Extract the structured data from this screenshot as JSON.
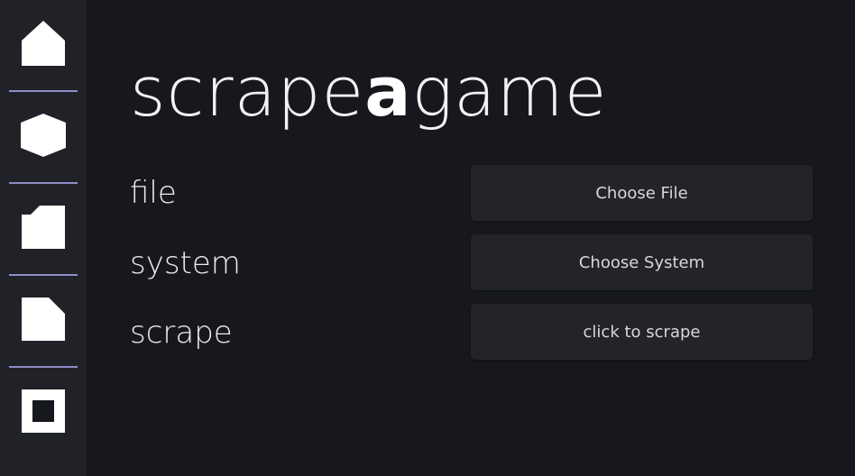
{
  "title": {
    "prefix": "scrape",
    "bold": "a",
    "suffix": "game"
  },
  "sidebar": {
    "items": [
      {
        "icon": "home-icon"
      },
      {
        "icon": "hexagon-icon"
      },
      {
        "icon": "folder-icon"
      },
      {
        "icon": "file-icon"
      },
      {
        "icon": "stop-square-icon"
      }
    ],
    "divider_color": "#8f8cc8"
  },
  "rows": [
    {
      "label": "file",
      "button": "Choose File"
    },
    {
      "label": "system",
      "button": "Choose System"
    },
    {
      "label": "scrape",
      "button": "click to scrape"
    }
  ],
  "colors": {
    "background": "#16181d",
    "sidebar": "#202227",
    "button": "#222428",
    "text": "#ececec"
  }
}
